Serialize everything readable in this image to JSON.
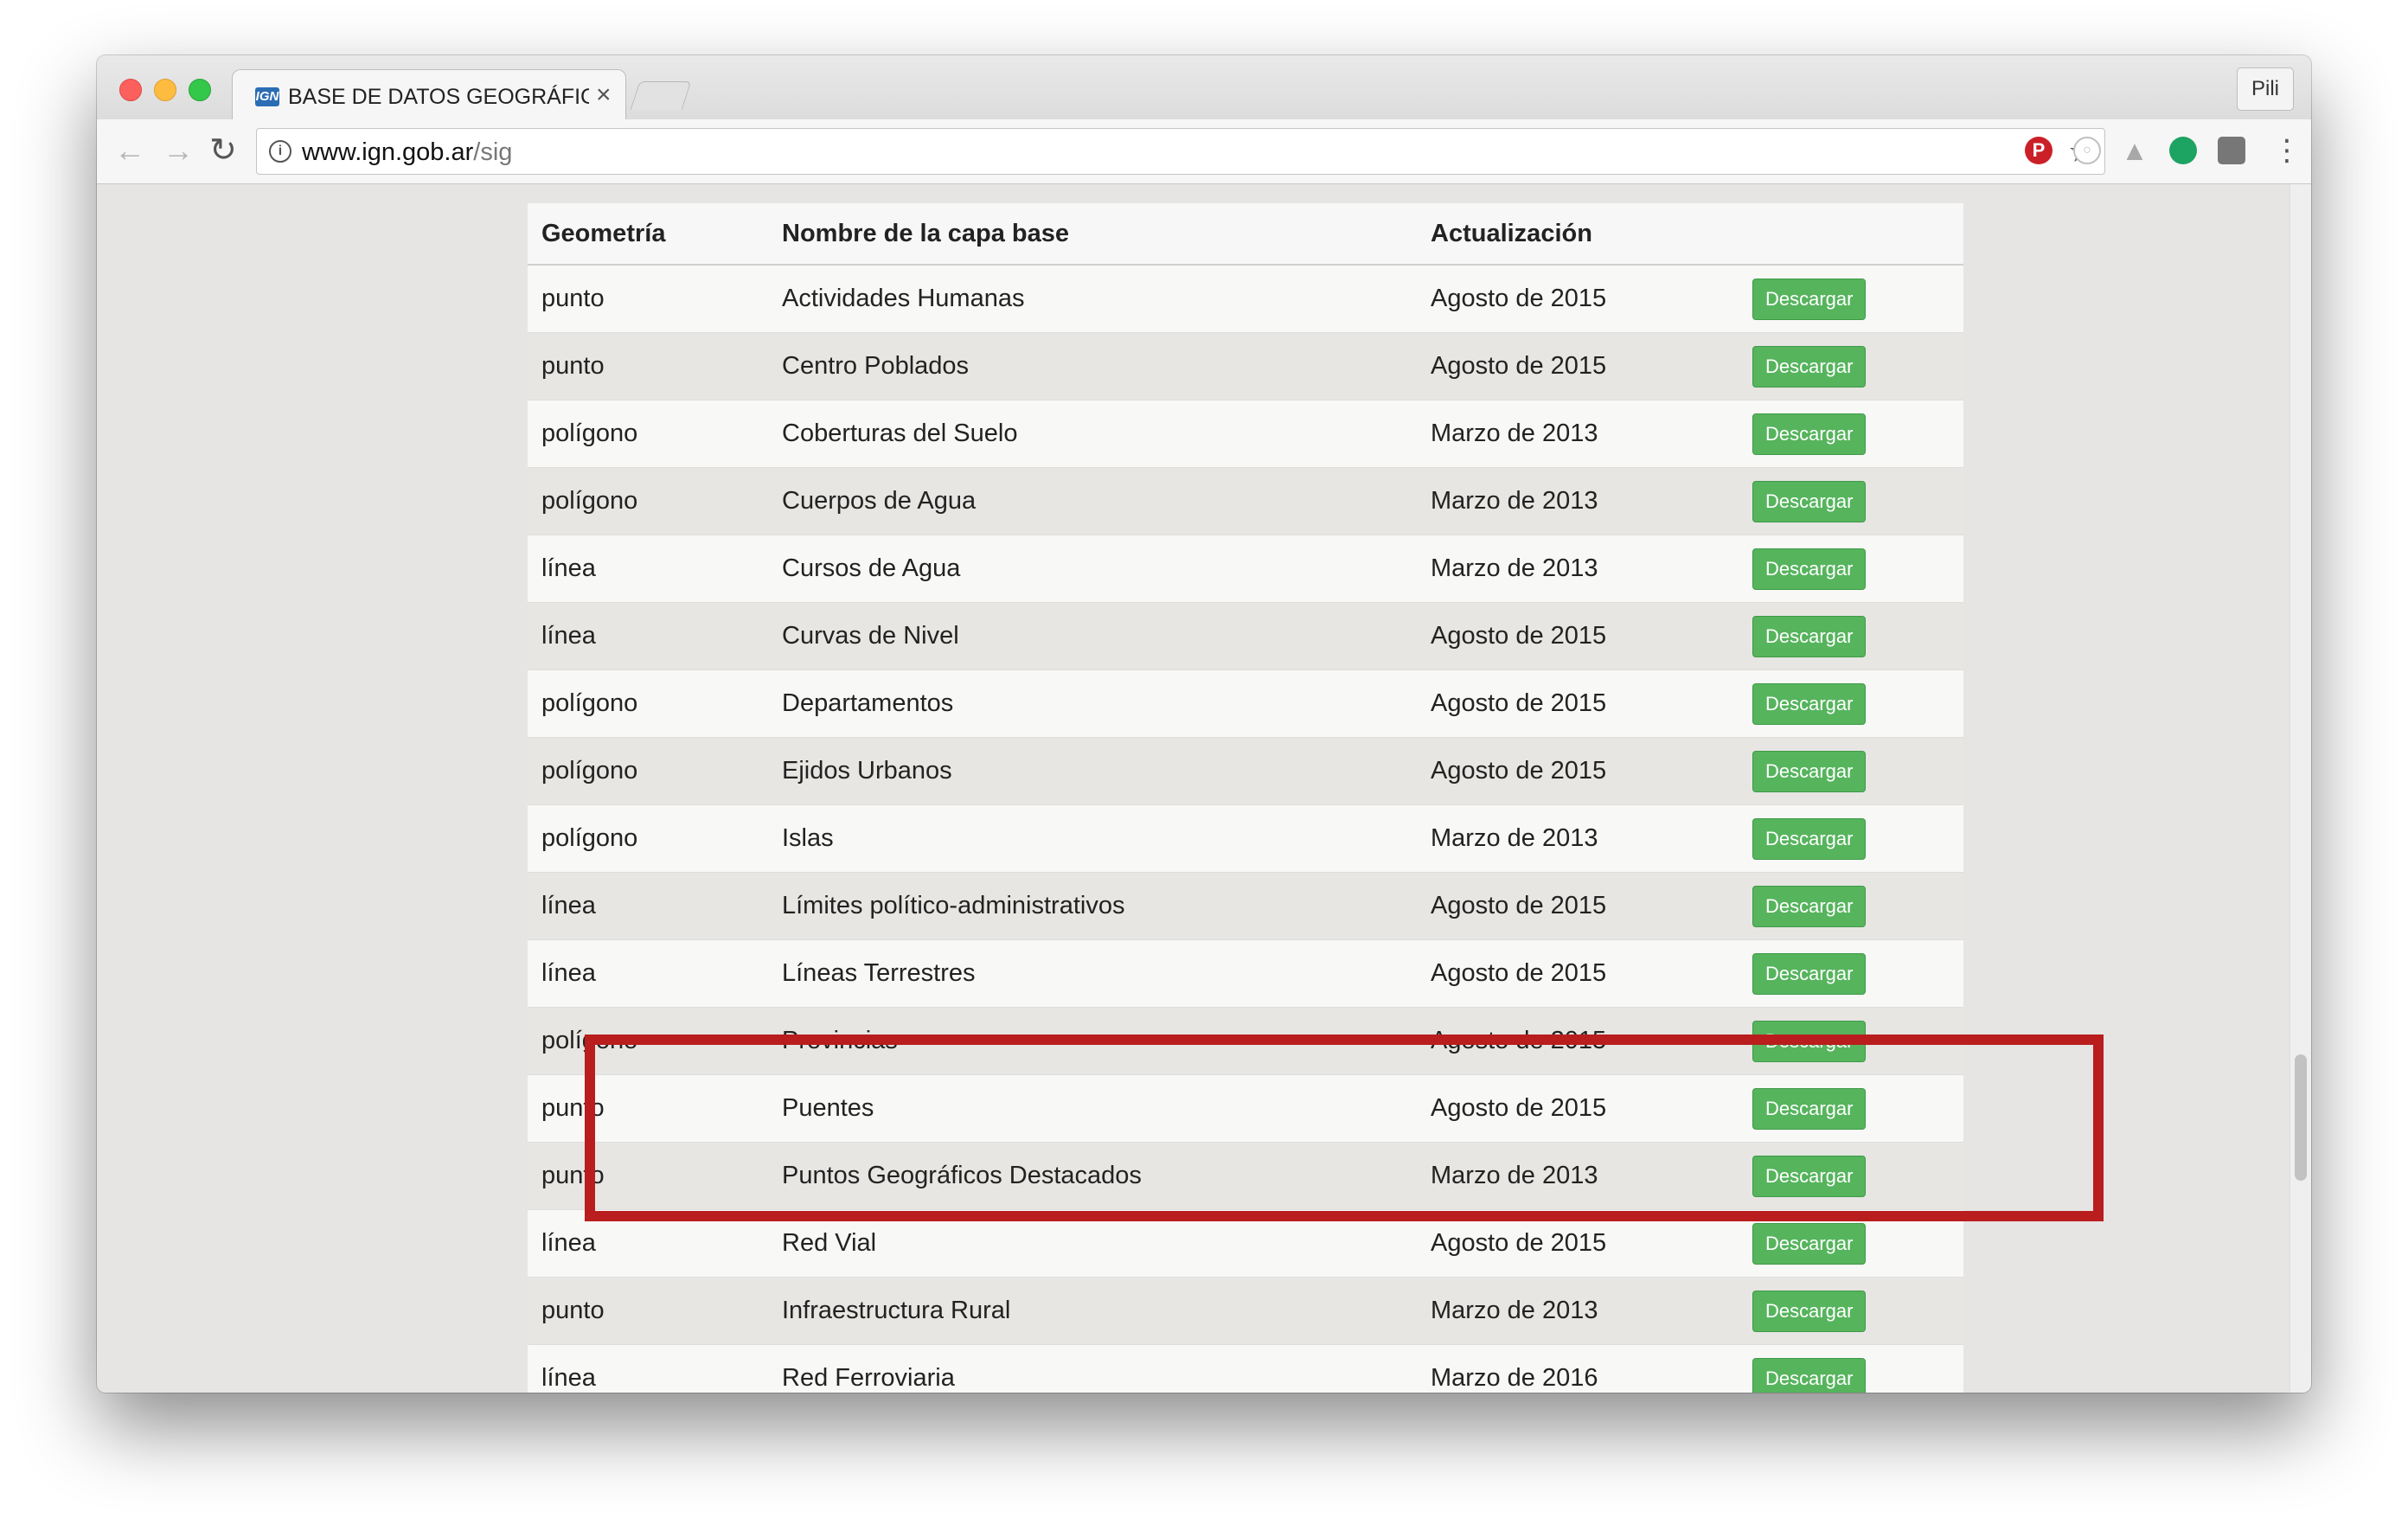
{
  "browser": {
    "tab_title": "BASE DE DATOS GEOGRÁFIC…",
    "tab_close": "×",
    "favicon_text": "IGN",
    "profile": "Pili",
    "url_host": "www.ign.gob.ar",
    "url_path": "/sig",
    "nav": {
      "back": "←",
      "forward": "→",
      "reload": "↻",
      "info": "i",
      "star": "☆",
      "menu": "⋮"
    }
  },
  "extensions": [
    "pinterest-icon",
    "circle-icon",
    "drive-icon",
    "hangouts-icon",
    "square-icon"
  ],
  "colors": {
    "highlight_border": "#b91d1d",
    "download_button": "#56b45d"
  },
  "table": {
    "headers": [
      "Geometría",
      "Nombre de la capa base",
      "Actualización",
      ""
    ],
    "rows": [
      {
        "geometry": "punto",
        "name": "Actividades Humanas",
        "updated": "Agosto de 2015",
        "action": "Descargar"
      },
      {
        "geometry": "punto",
        "name": "Centro Poblados",
        "updated": "Agosto de 2015",
        "action": "Descargar"
      },
      {
        "geometry": "polígono",
        "name": "Coberturas del Suelo",
        "updated": "Marzo de 2013",
        "action": "Descargar"
      },
      {
        "geometry": "polígono",
        "name": "Cuerpos de Agua",
        "updated": "Marzo de 2013",
        "action": "Descargar"
      },
      {
        "geometry": "línea",
        "name": "Cursos de Agua",
        "updated": "Marzo de 2013",
        "action": "Descargar"
      },
      {
        "geometry": "línea",
        "name": "Curvas de Nivel",
        "updated": "Agosto de 2015",
        "action": "Descargar"
      },
      {
        "geometry": "polígono",
        "name": "Departamentos",
        "updated": "Agosto de 2015",
        "action": "Descargar"
      },
      {
        "geometry": "polígono",
        "name": "Ejidos Urbanos",
        "updated": "Agosto de 2015",
        "action": "Descargar"
      },
      {
        "geometry": "polígono",
        "name": "Islas",
        "updated": "Marzo de 2013",
        "action": "Descargar"
      },
      {
        "geometry": "línea",
        "name": "Límites político-administrativos",
        "updated": "Agosto de 2015",
        "action": "Descargar"
      },
      {
        "geometry": "línea",
        "name": "Líneas Terrestres",
        "updated": "Agosto de 2015",
        "action": "Descargar"
      },
      {
        "geometry": "polígono",
        "name": "Provincias",
        "updated": "Agosto de 2015",
        "action": "Descargar"
      },
      {
        "geometry": "punto",
        "name": "Puentes",
        "updated": "Agosto de 2015",
        "action": "Descargar"
      },
      {
        "geometry": "punto",
        "name": "Puntos Geográficos Destacados",
        "updated": "Marzo de 2013",
        "action": "Descargar"
      },
      {
        "geometry": "línea",
        "name": "Red Vial",
        "updated": "Agosto de 2015",
        "action": "Descargar"
      },
      {
        "geometry": "punto",
        "name": "Infraestructura Rural",
        "updated": "Marzo de 2013",
        "action": "Descargar"
      },
      {
        "geometry": "línea",
        "name": "Red Ferroviaria",
        "updated": "Marzo de 2016",
        "action": "Descargar"
      }
    ],
    "highlighted_rows": [
      "Provincias",
      "Puentes"
    ]
  }
}
